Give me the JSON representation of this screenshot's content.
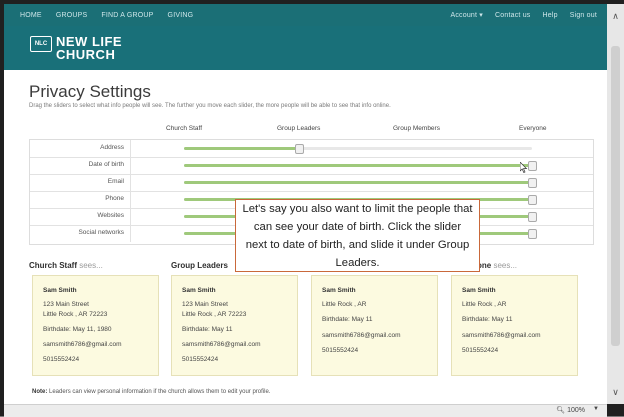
{
  "nav": {
    "left": [
      "HOME",
      "GROUPS",
      "FIND A GROUP",
      "GIVING"
    ],
    "right": [
      "Account ▾",
      "Contact us",
      "Help",
      "Sign out"
    ]
  },
  "brand": {
    "logo": "NLC",
    "line1": "NEW LIFE",
    "line2": "CHURCH"
  },
  "page": {
    "title": "Privacy Settings",
    "subtitle": "Drag the sliders to select what info people will see. The further you move each slider, the more people will be able to see that info online."
  },
  "columns": [
    "Church Staff",
    "Group Leaders",
    "Group Members",
    "Everyone"
  ],
  "sliders": [
    {
      "label": "Address",
      "level": 0.33
    },
    {
      "label": "Date of birth",
      "level": 1.0
    },
    {
      "label": "Email",
      "level": 1.0
    },
    {
      "label": "Phone",
      "level": 1.0
    },
    {
      "label": "Websites",
      "level": 1.0
    },
    {
      "label": "Social networks",
      "level": 1.0
    }
  ],
  "callout": "Let's say you also want to limit the people that can see your date of birth.  Click the slider next to date of birth, and slide it under Group Leaders.",
  "sees": {
    "staff": {
      "bold": "Church Staff",
      "light": " sees..."
    },
    "leaders": {
      "bold": "Group Leaders",
      "light": ""
    },
    "everyone": {
      "bold": "one",
      "light": " sees..."
    }
  },
  "cards": [
    {
      "name": "Sam Smith",
      "l1": "123 Main Street",
      "l2": "Little Rock , AR  72223",
      "birth": "Birthdate: May 11, 1980",
      "email": "samsmith6786@gmail.com",
      "phone": "5015552424"
    },
    {
      "name": "Sam Smith",
      "l1": "123 Main Street",
      "l2": "Little Rock , AR  72223",
      "birth": "Birthdate: May 11",
      "email": "samsmith6786@gmail.com",
      "phone": "5015552424"
    },
    {
      "name": "Sam Smith",
      "l1": "Little Rock , AR",
      "l2": "",
      "birth": "Birthdate: May 11",
      "email": "samsmith6786@gmail.com",
      "phone": "5015552424"
    },
    {
      "name": "Sam Smith",
      "l1": "Little Rock , AR",
      "l2": "",
      "birth": "Birthdate: May 11",
      "email": "samsmith6786@gmail.com",
      "phone": "5015552424"
    }
  ],
  "note": {
    "bold": "Note:",
    "text": " Leaders can view personal information if the church allows them to edit your profile."
  },
  "status": {
    "zoom": "100%"
  },
  "colors": {
    "nav": "#1b6f76",
    "fill": "#9fc97b",
    "card": "#fcfae0",
    "callout_border": "#c9683a"
  }
}
